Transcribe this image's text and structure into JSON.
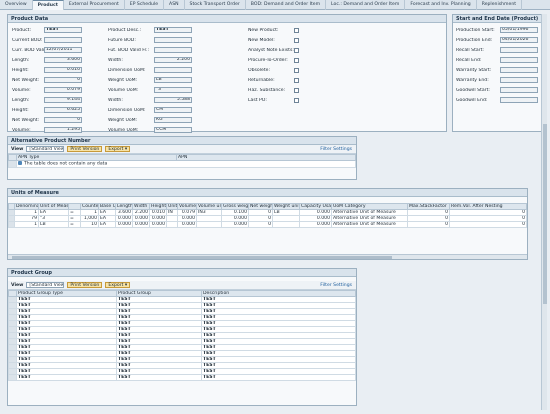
{
  "tabs": [
    "Overview",
    "Product",
    "External Procurement",
    "EP Schedule",
    "ASN",
    "Stock Transport Order",
    "BOD: Demand and Order Item",
    "Loc.: Demand and Order Item",
    "Forecast and Inv. Planning",
    "Replenishment"
  ],
  "product_data": {
    "title": "Product Data",
    "col1": [
      {
        "label": "Product:",
        "value": "TEST"
      },
      {
        "label": "Current BOD:",
        "value": ""
      },
      {
        "label": "Curr. BOD Valid Fr.:",
        "value": "12/07/2011"
      },
      {
        "label": "Length:",
        "value": "3.600"
      },
      {
        "label": "Height:",
        "value": "0.010"
      },
      {
        "label": "Net Weight:",
        "value": "0"
      },
      {
        "label": "Volume:",
        "value": "0.079"
      },
      {
        "label": "Length:",
        "value": "9.144"
      },
      {
        "label": "Height:",
        "value": "6.625"
      },
      {
        "label": "Net Weight:",
        "value": "0"
      },
      {
        "label": "Volume:",
        "value": "1.295"
      }
    ],
    "col2": [
      {
        "label": "Product Desc.:",
        "value": "TEST"
      },
      {
        "label": "Future BOD:",
        "value": ""
      },
      {
        "label": "Fut. BOD Valid Fr.:",
        "value": ""
      },
      {
        "label": "Width:",
        "value": "2.200"
      },
      {
        "label": "Dimension UoM:",
        "value": "\""
      },
      {
        "label": "Weight UoM:",
        "value": "LB"
      },
      {
        "label": "Volume UoM:",
        "value": "\"3"
      },
      {
        "label": "Width:",
        "value": "5.588"
      },
      {
        "label": "Dimension UoM:",
        "value": "CM"
      },
      {
        "label": "Weight UoM:",
        "value": "KG"
      },
      {
        "label": "Volume UoM:",
        "value": "CCM"
      }
    ],
    "col3": [
      {
        "label": "New Product:"
      },
      {
        "label": "New Model:"
      },
      {
        "label": "Analyst Note Exists:"
      },
      {
        "label": "Procure-To-Order:"
      },
      {
        "label": "Obsolete:"
      },
      {
        "label": "Returnable:"
      },
      {
        "label": "Haz. Substance:"
      },
      {
        "label": "Last PO:"
      }
    ]
  },
  "dates": {
    "title": "Start and End Date (Product)",
    "rows": [
      {
        "label": "Production Start:",
        "value": "05/01/1996"
      },
      {
        "label": "Production End:",
        "value": "04/01/2026"
      },
      {
        "label": "Recall Start:",
        "value": ""
      },
      {
        "label": "Recall End:",
        "value": ""
      },
      {
        "label": "Warranty Start:",
        "value": ""
      },
      {
        "label": "Warranty End:",
        "value": ""
      },
      {
        "label": "Goodwill Start:",
        "value": ""
      },
      {
        "label": "Goodwill End:",
        "value": ""
      }
    ]
  },
  "apn": {
    "title": "Alternative Product Number",
    "view_label": "View",
    "view_value": "[Standard View]",
    "print_label": "Print Version",
    "export_label": "Export",
    "filter_label": "Filter",
    "settings_label": "Settings",
    "columns": [
      "APN Type",
      "APN"
    ],
    "empty_text": "The table does not contain any data"
  },
  "uom": {
    "title": "Units of Measure",
    "columns": [
      "Denominator",
      "Unit of Measure",
      "",
      "Counter",
      "Base Unit",
      "Length",
      "Width",
      "Height",
      "Unit",
      "Volume",
      "Volume unit",
      "Gross weight",
      "Net weight",
      "Weight unit",
      "Capacity Usage",
      "UoM Category",
      "Max.StackFactor",
      "Rem.Vol. After Nesting"
    ],
    "rows": [
      [
        "1",
        "EA",
        "=",
        "1",
        "EA",
        "3.600",
        "2.200",
        "0.010",
        "IN",
        "0.079",
        "IN3",
        "0.100",
        "0",
        "LB",
        "0.000",
        "Alternative Unit of Measure",
        "0",
        "0"
      ],
      [
        "79",
        "\"3",
        "=",
        "1,000",
        "EA",
        "0.000",
        "0.000",
        "0.000",
        "",
        "0.000",
        "",
        "0.000",
        "0",
        "",
        "0.000",
        "Alternative Unit of Measure",
        "0",
        "0"
      ],
      [
        "1",
        "LB",
        "=",
        "10",
        "EA",
        "0.000",
        "0.000",
        "0.000",
        "",
        "0.000",
        "",
        "0.000",
        "0",
        "",
        "0.000",
        "Alternative Unit of Measure",
        "0",
        "0"
      ]
    ]
  },
  "product_group": {
    "title": "Product Group",
    "view_label": "View",
    "view_value": "[Standard View]",
    "print_label": "Print Version",
    "export_label": "Export",
    "filter_label": "Filter",
    "settings_label": "Settings",
    "columns": [
      "Product Group Type",
      "Product Group",
      "Description"
    ],
    "rows": [
      [
        "TEST",
        "TEST",
        "TEST"
      ],
      [
        "TEST",
        "TEST",
        "TEST"
      ],
      [
        "TEST",
        "TEST",
        "TEST"
      ],
      [
        "TEST",
        "TEST",
        "TEST"
      ],
      [
        "TEST",
        "TEST",
        "TEST"
      ],
      [
        "TEST",
        "TEST",
        "TEST"
      ],
      [
        "TEST",
        "TEST",
        "TEST"
      ],
      [
        "TEST",
        "TEST",
        "TEST"
      ],
      [
        "TEST",
        "TEST",
        "TEST"
      ],
      [
        "TEST",
        "TEST",
        "TEST"
      ],
      [
        "TEST",
        "TEST",
        "TEST"
      ],
      [
        "TEST",
        "TEST",
        "TEST"
      ],
      [
        "TEST",
        "TEST",
        "TEST"
      ],
      [
        "TEST",
        "TEST",
        "TEST"
      ]
    ]
  },
  "colors": {
    "accent": "#f7e3a6",
    "header": "#d9e3ec",
    "link": "#1f5f9e"
  }
}
